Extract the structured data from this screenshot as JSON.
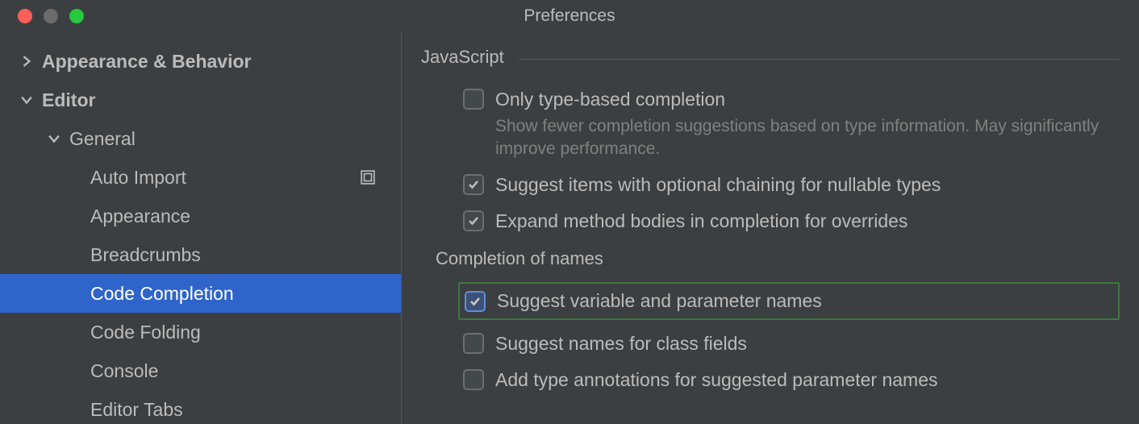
{
  "window": {
    "title": "Preferences"
  },
  "sidebar": {
    "items": [
      {
        "label": "Appearance & Behavior",
        "expanded": false,
        "level": "top-level"
      },
      {
        "label": "Editor",
        "expanded": true,
        "level": "level-1"
      },
      {
        "label": "General",
        "expanded": true,
        "level": "level-2"
      },
      {
        "label": "Auto Import",
        "level": "level-3",
        "badge": true
      },
      {
        "label": "Appearance",
        "level": "level-3"
      },
      {
        "label": "Breadcrumbs",
        "level": "level-3"
      },
      {
        "label": "Code Completion",
        "level": "level-3",
        "selected": true
      },
      {
        "label": "Code Folding",
        "level": "level-3"
      },
      {
        "label": "Console",
        "level": "level-3"
      },
      {
        "label": "Editor Tabs",
        "level": "level-3"
      }
    ]
  },
  "main": {
    "section_title": "JavaScript",
    "options": [
      {
        "label": "Only type-based completion",
        "checked": false,
        "desc": "Show fewer completion suggestions based on type information. May significantly improve performance."
      },
      {
        "label": "Suggest items with optional chaining for nullable types",
        "checked": true
      },
      {
        "label": "Expand method bodies in completion for overrides",
        "checked": true
      }
    ],
    "subsection_title": "Completion of names",
    "sub_options": [
      {
        "label": "Suggest variable and parameter names",
        "checked": true,
        "highlighted": true
      },
      {
        "label": "Suggest names for class fields",
        "checked": false
      },
      {
        "label": "Add type annotations for suggested parameter names",
        "checked": false
      }
    ]
  }
}
